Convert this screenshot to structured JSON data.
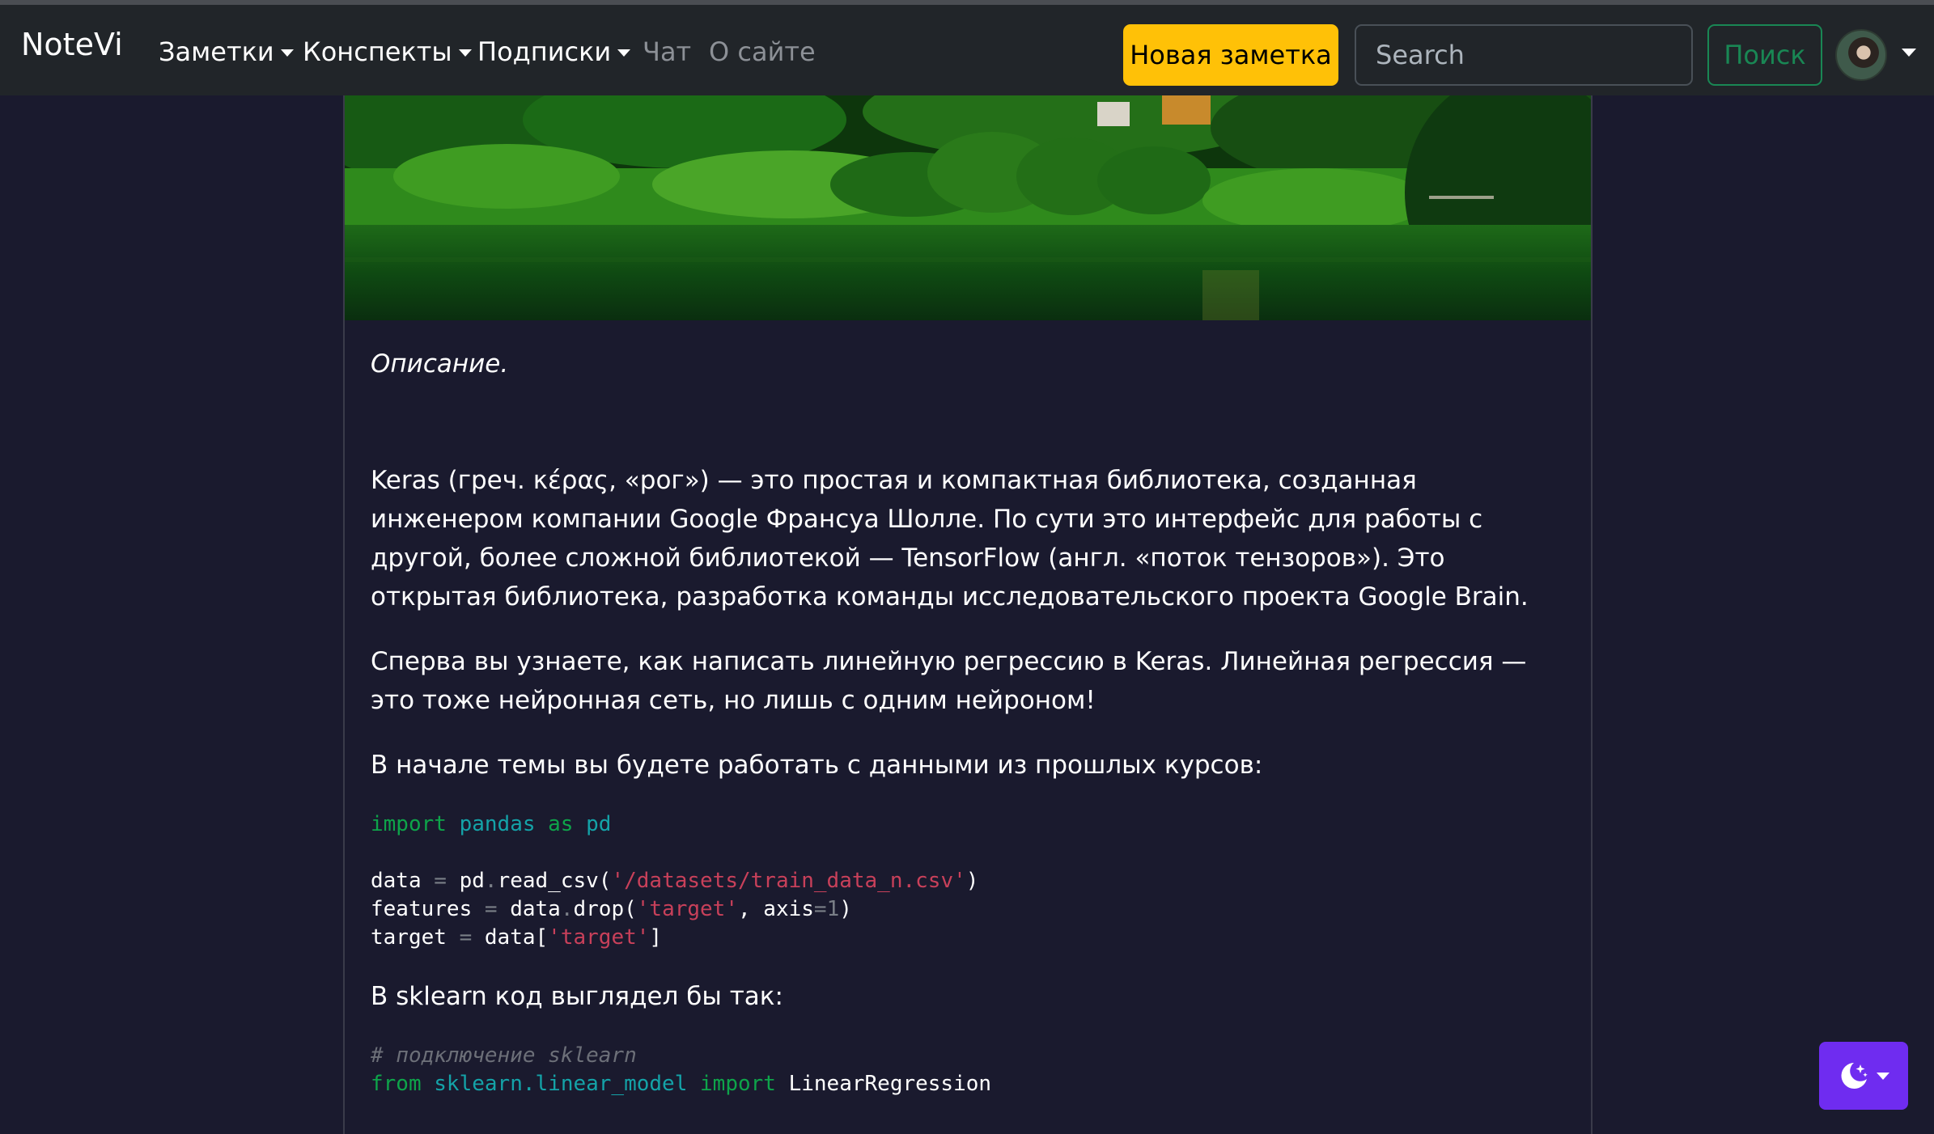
{
  "navbar": {
    "brand": "NoteVi",
    "items": [
      {
        "label": "Заметки",
        "dropdown": true
      },
      {
        "label": "Конспекты",
        "dropdown": true
      },
      {
        "label": "Подписки",
        "dropdown": true
      },
      {
        "label": "Чат",
        "dropdown": false
      },
      {
        "label": "О сайте",
        "dropdown": false
      }
    ],
    "new_note_label": "Новая заметка",
    "search_placeholder": "Search",
    "search_button_label": "Поиск"
  },
  "article": {
    "description_label": "Описание.",
    "paragraph1": "Keras (греч. κέρας, «рог») — это простая и компактная библиотека, созданная инженером компании Google Франсуа Шолле. По сути это интерфейс для работы с другой, более сложной библиотекой — TensorFlow (англ. «поток тензоров»). Это открытая библиотека, разработка команды исследовательского проекта Google Brain.",
    "paragraph2": "Сперва вы узнаете, как написать линейную регрессию в Keras. Линейная регрессия — это тоже нейронная сеть, но лишь с одним нейроном!",
    "paragraph3": "В начале темы вы будете работать с данными из прошлых курсов:",
    "paragraph4": "В sklearn код выглядел бы так:",
    "code1": {
      "kw_import": "import",
      "mod_pandas": "pandas",
      "kw_as": "as",
      "mod_pd": "pd",
      "line3_a": "data ",
      "line3_b": "= ",
      "line3_c": "pd",
      "line3_d": ".",
      "line3_e": "read_csv(",
      "line3_str": "'/datasets/train_data_n.csv'",
      "line3_f": ")",
      "line4_a": "features ",
      "line4_b": "= ",
      "line4_c": "data",
      "line4_d": ".",
      "line4_e": "drop(",
      "line4_str": "'target'",
      "line4_f": ", axis",
      "line4_g": "=",
      "line4_num": "1",
      "line4_h": ")",
      "line5_a": "target ",
      "line5_b": "= ",
      "line5_c": "data[",
      "line5_str": "'target'",
      "line5_d": "]"
    },
    "code2": {
      "comment": "# подключение sklearn",
      "kw_from": "from",
      "mod_sklearn": "sklearn.linear_model",
      "kw_import": "import",
      "cls": "LinearRegression"
    }
  },
  "theme_toggle": {
    "icon": "moon-stars-icon"
  },
  "colors": {
    "navbar_bg": "#212529",
    "page_bg": "#1a1a2e",
    "new_note_bg": "#ffc107",
    "search_btn": "#198754",
    "theme_btn": "#6f2cf0"
  }
}
